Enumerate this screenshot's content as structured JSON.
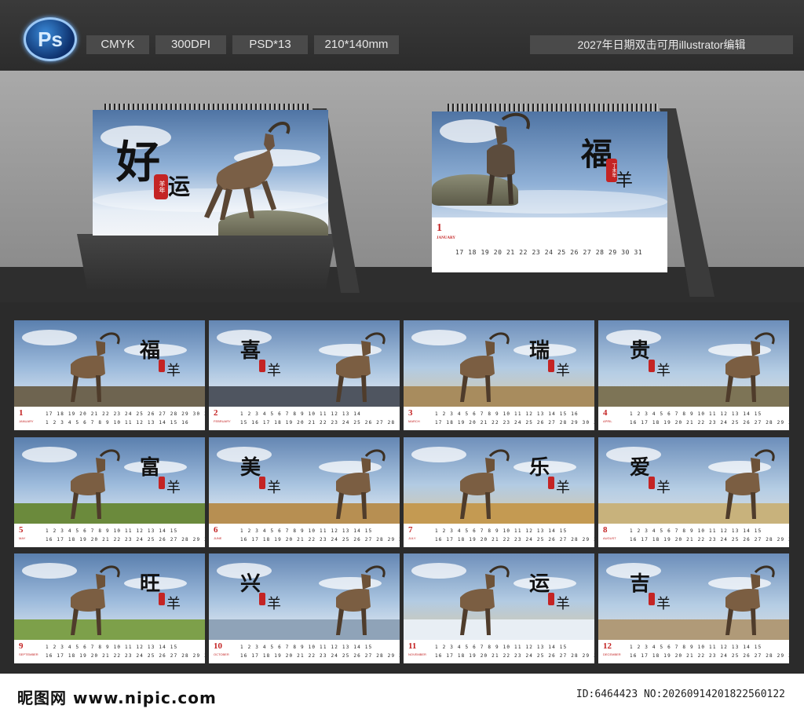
{
  "header": {
    "app_badge": "Ps",
    "specs": [
      "CMYK",
      "300DPI",
      "PSD*13",
      "210*140mm"
    ],
    "note": "2027年日期双击可用illustrator编辑"
  },
  "mockups": {
    "left": {
      "title_chars": [
        "好",
        "运"
      ],
      "seal": "羊年"
    },
    "right": {
      "title_char": "福",
      "sub_char": "羊",
      "seal": "丁未年",
      "month_number": "1",
      "month_name": "JANUARY",
      "days_row": "17 18 19 20 21 22 23 24 25 26 27 28 29 30 31"
    }
  },
  "months": [
    {
      "n": "1",
      "name": "JANUARY",
      "char": "福",
      "animal": "羊",
      "r1": "17 18 19 20 21 22 23 24 25 26 27 28 29 30 31",
      "r2": "1 2 3 4 5 6 7 8 9 10 11 12 13 14 15 16"
    },
    {
      "n": "2",
      "name": "FEBRUARY",
      "char": "喜",
      "animal": "羊",
      "r1": "1 2 3 4 5 6 7 8 9 10 11 12 13 14",
      "r2": "15 16 17 18 19 20 21 22 23 24 25 26 27 28"
    },
    {
      "n": "3",
      "name": "MARCH",
      "char": "瑞",
      "animal": "羊",
      "r1": "1 2 3 4 5 6 7 8 9 10 11 12 13 14 15 16",
      "r2": "17 18 19 20 21 22 23 24 25 26 27 28 29 30 31"
    },
    {
      "n": "4",
      "name": "APRIL",
      "char": "贵",
      "animal": "羊",
      "r1": "1 2 3 4 5 6 7 8 9 10 11 12 13 14 15",
      "r2": "16 17 18 19 20 21 22 23 24 25 26 27 28 29 30"
    },
    {
      "n": "5",
      "name": "MAY",
      "char": "富",
      "animal": "羊",
      "r1": "1 2 3 4 5 6 7 8 9 10 11 12 13 14 15",
      "r2": "16 17 18 19 20 21 22 23 24 25 26 27 28 29 30 31"
    },
    {
      "n": "6",
      "name": "JUNE",
      "char": "美",
      "animal": "羊",
      "r1": "1 2 3 4 5 6 7 8 9 10 11 12 13 14 15",
      "r2": "16 17 18 19 20 21 22 23 24 25 26 27 28 29 30"
    },
    {
      "n": "7",
      "name": "JULY",
      "char": "乐",
      "animal": "羊",
      "r1": "1 2 3 4 5 6 7 8 9 10 11 12 13 14 15",
      "r2": "16 17 18 19 20 21 22 23 24 25 26 27 28 29 30 31"
    },
    {
      "n": "8",
      "name": "AUGUST",
      "char": "爱",
      "animal": "羊",
      "r1": "1 2 3 4 5 6 7 8 9 10 11 12 13 14 15",
      "r2": "16 17 18 19 20 21 22 23 24 25 26 27 28 29 30 31"
    },
    {
      "n": "9",
      "name": "SEPTEMBER",
      "char": "旺",
      "animal": "羊",
      "r1": "1 2 3 4 5 6 7 8 9 10 11 12 13 14 15",
      "r2": "16 17 18 19 20 21 22 23 24 25 26 27 28 29 30"
    },
    {
      "n": "10",
      "name": "OCTOBER",
      "char": "兴",
      "animal": "羊",
      "r1": "1 2 3 4 5 6 7 8 9 10 11 12 13 14 15",
      "r2": "16 17 18 19 20 21 22 23 24 25 26 27 28 29 30 31"
    },
    {
      "n": "11",
      "name": "NOVEMBER",
      "char": "运",
      "animal": "羊",
      "r1": "1 2 3 4 5 6 7 8 9 10 11 12 13 14 15",
      "r2": "16 17 18 19 20 21 22 23 24 25 26 27 28 29 30"
    },
    {
      "n": "12",
      "name": "DECEMBER",
      "char": "吉",
      "animal": "羊",
      "r1": "1 2 3 4 5 6 7 8 9 10 11 12 13 14 15",
      "r2": "16 17 18 19 20 21 22 23 24 25 26 27 28 29 30 31"
    }
  ],
  "footer": {
    "site": "昵图网 www.nipic.com",
    "id": "ID:6464423 NO:20260914201822560122"
  }
}
